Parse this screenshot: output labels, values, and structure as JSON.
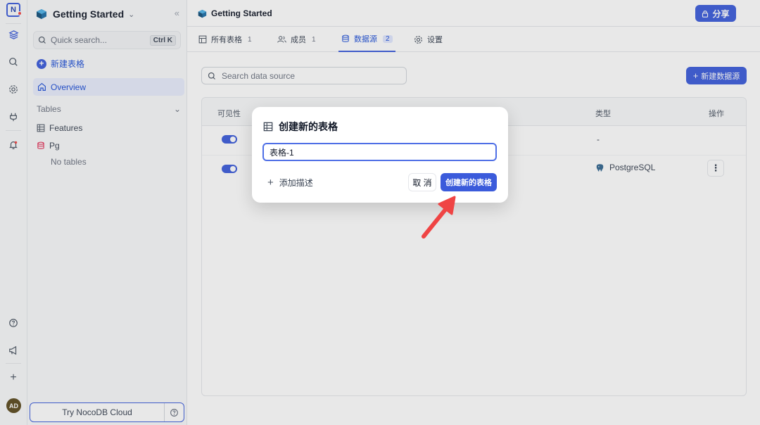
{
  "workspace": {
    "title": "Getting Started"
  },
  "sidebar": {
    "quick_search_placeholder": "Quick search...",
    "shortcut": "Ctrl K",
    "new_table": "新建表格",
    "overview": "Overview",
    "tables_heading": "Tables",
    "items": [
      {
        "label": "Features",
        "icon": "grid-icon"
      },
      {
        "label": "Pg",
        "icon": "database-icon"
      }
    ],
    "no_tables": "No tables",
    "try_cloud": "Try NocoDB Cloud"
  },
  "topbar": {
    "breadcrumb": "Getting Started",
    "share": "分享"
  },
  "tabs": [
    {
      "label": "所有表格",
      "count": "1"
    },
    {
      "label": "成员",
      "count": "1"
    },
    {
      "label": "数据源",
      "count": "2"
    },
    {
      "label": "设置"
    }
  ],
  "datasource": {
    "search_placeholder": "Search data source",
    "new_button": "新建数据源",
    "columns": {
      "visibility": "可见性",
      "type": "类型",
      "actions": "操作"
    },
    "rows": [
      {
        "type": "-"
      },
      {
        "type": "PostgreSQL"
      }
    ]
  },
  "modal": {
    "title": "创建新的表格",
    "input_value": "表格-1",
    "add_description": "添加描述",
    "cancel": "取 消",
    "create": "创建新的表格"
  },
  "colors": {
    "accent": "#3b5bdb",
    "arrow": "#ef4444"
  }
}
